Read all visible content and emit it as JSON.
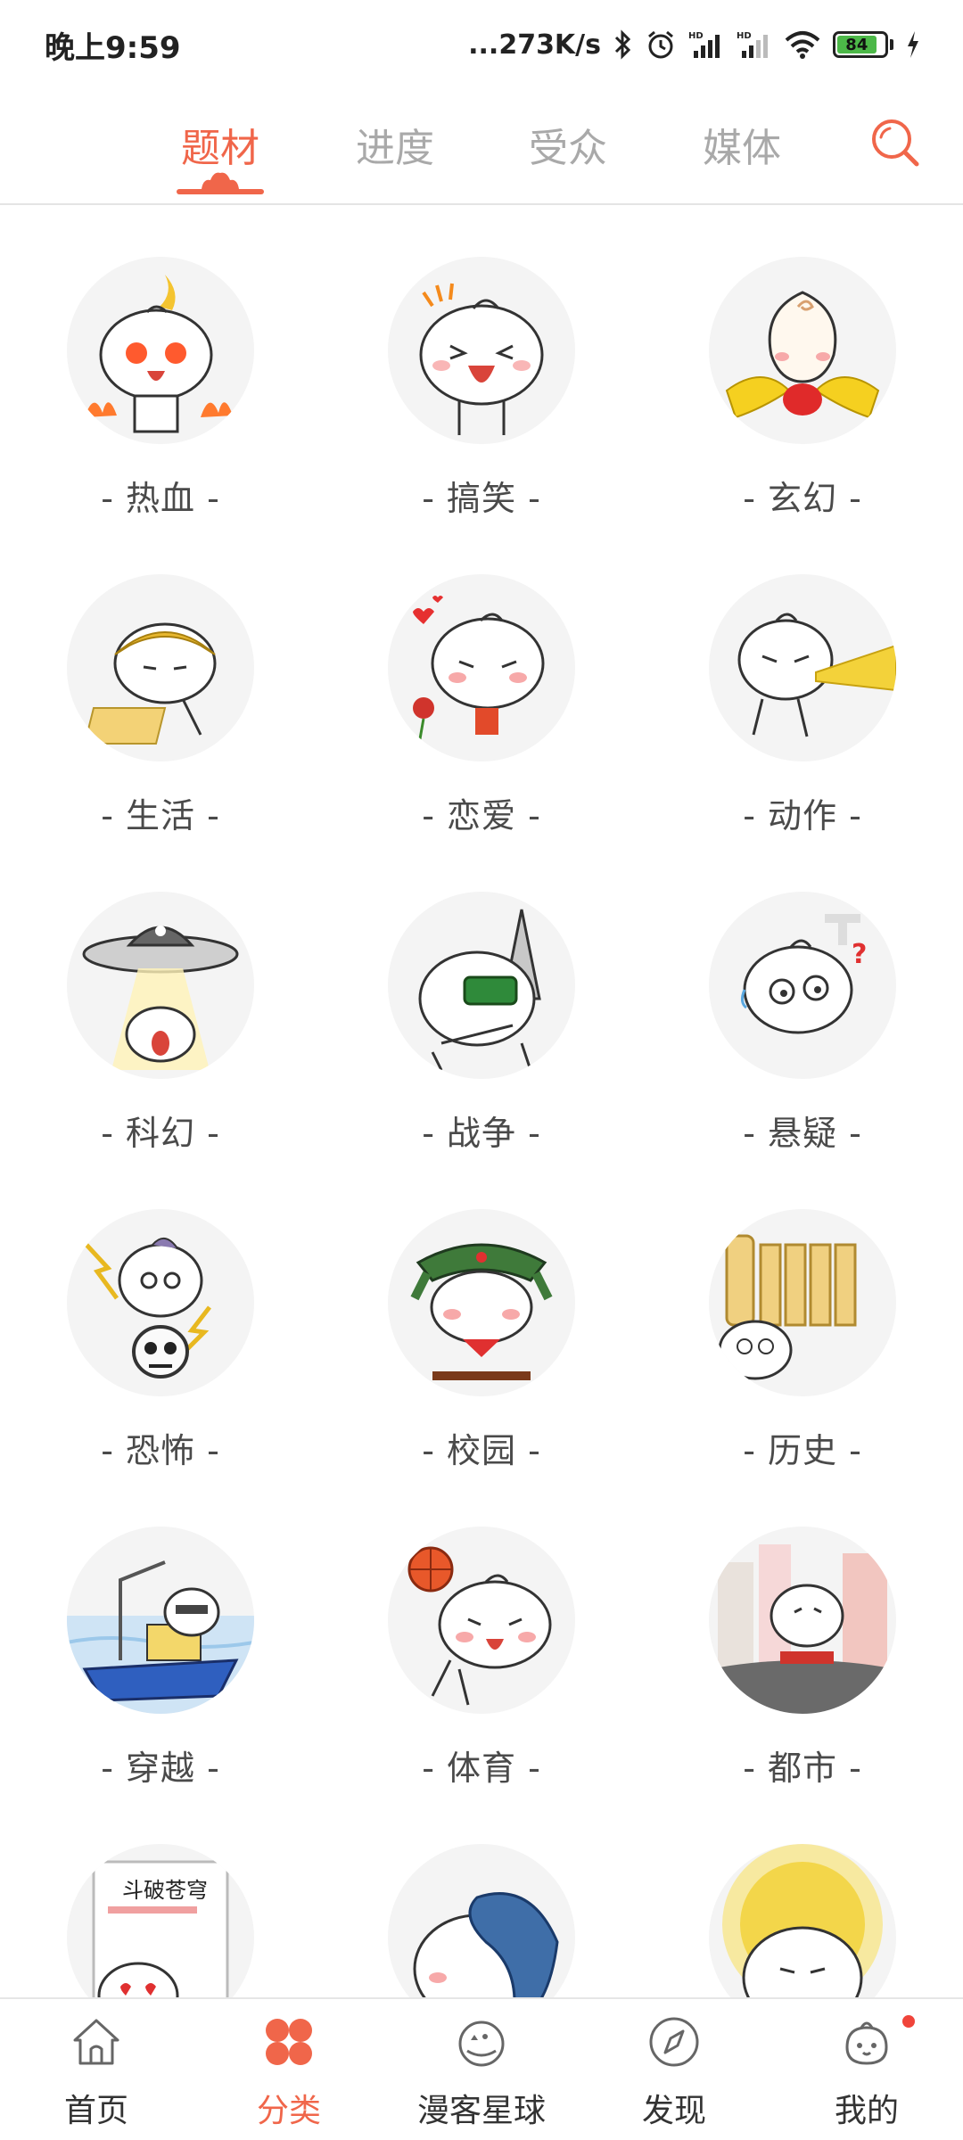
{
  "status_bar": {
    "time": "晚上9:59",
    "network_speed": "...273K/s",
    "battery_level": "84",
    "icons": [
      "bluetooth-icon",
      "alarm-icon",
      "signal-hd-icon",
      "signal-hd-icon",
      "wifi-icon",
      "battery-icon",
      "charging-icon"
    ]
  },
  "top_tabs": {
    "items": [
      {
        "label": "题材",
        "active": true
      },
      {
        "label": "进度",
        "active": false
      },
      {
        "label": "受众",
        "active": false
      },
      {
        "label": "媒体",
        "active": false
      }
    ],
    "search_icon": "search-icon"
  },
  "categories": [
    {
      "label": "- 热血 -",
      "icon": "hot-blood-mascot"
    },
    {
      "label": "- 搞笑 -",
      "icon": "funny-mascot"
    },
    {
      "label": "- 玄幻 -",
      "icon": "fantasy-mascot"
    },
    {
      "label": "- 生活 -",
      "icon": "life-mascot"
    },
    {
      "label": "- 恋爱 -",
      "icon": "romance-mascot"
    },
    {
      "label": "- 动作 -",
      "icon": "action-mascot"
    },
    {
      "label": "- 科幻 -",
      "icon": "scifi-mascot"
    },
    {
      "label": "- 战争 -",
      "icon": "war-mascot"
    },
    {
      "label": "- 悬疑 -",
      "icon": "mystery-mascot"
    },
    {
      "label": "- 恐怖 -",
      "icon": "horror-mascot"
    },
    {
      "label": "- 校园 -",
      "icon": "campus-mascot"
    },
    {
      "label": "- 历史 -",
      "icon": "history-mascot"
    },
    {
      "label": "- 穿越 -",
      "icon": "time-travel-mascot"
    },
    {
      "label": "- 体育 -",
      "icon": "sports-mascot"
    },
    {
      "label": "- 都市 -",
      "icon": "urban-mascot"
    },
    {
      "label": "",
      "icon": "book-mascot",
      "book_title": "斗破苍穹"
    },
    {
      "label": "",
      "icon": "blue-hair-mascot"
    },
    {
      "label": "",
      "icon": "halo-mascot"
    }
  ],
  "bottom_nav": {
    "items": [
      {
        "label": "首页",
        "icon": "home-icon",
        "active": false
      },
      {
        "label": "分类",
        "icon": "category-icon",
        "active": true
      },
      {
        "label": "漫客星球",
        "icon": "planet-icon",
        "active": false
      },
      {
        "label": "发现",
        "icon": "compass-icon",
        "active": false
      },
      {
        "label": "我的",
        "icon": "profile-icon",
        "active": false,
        "badge": true
      }
    ]
  },
  "colors": {
    "accent": "#f0664a",
    "inactive_tab": "#a9a9a9",
    "avatar_bg": "#f4f4f4",
    "battery": "#4cb848"
  }
}
